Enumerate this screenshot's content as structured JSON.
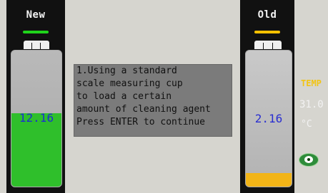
{
  "left_panel": {
    "title": "New",
    "value": "12.16",
    "fill_fraction": 0.54,
    "accent_color": "#1fd41b",
    "fill_color": "#2fbf2b"
  },
  "right_panel": {
    "title": "Old",
    "value": "2.16",
    "fill_fraction": 0.1,
    "accent_color": "#f6c000",
    "fill_color": "#f2b417"
  },
  "message": {
    "lines": [
      "1.Using a standard",
      "scale measuring cup",
      "to load a certain",
      "amount of cleaning agent",
      "Press ENTER to continue"
    ]
  },
  "temperature": {
    "label": "TEMP",
    "value": "31.0",
    "unit": "°C"
  },
  "icons": {
    "status": "eye-icon"
  }
}
